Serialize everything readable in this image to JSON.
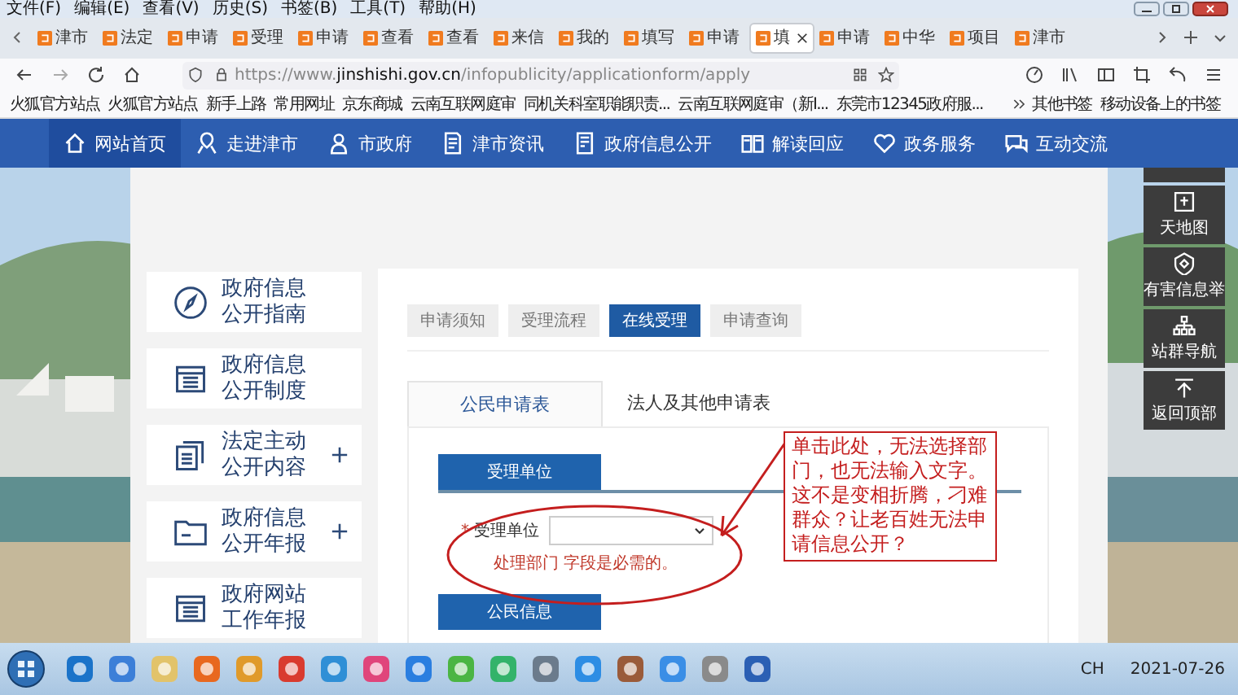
{
  "menu_bar": [
    "文件(F)",
    "编辑(E)",
    "查看(V)",
    "历史(S)",
    "书签(B)",
    "工具(T)",
    "帮助(H)"
  ],
  "browser_tabs": [
    {
      "label": "津市",
      "selected": false
    },
    {
      "label": "法定",
      "selected": false
    },
    {
      "label": "申请",
      "selected": false
    },
    {
      "label": "受理",
      "selected": false
    },
    {
      "label": "申请",
      "selected": false
    },
    {
      "label": "查看",
      "selected": false
    },
    {
      "label": "查看",
      "selected": false
    },
    {
      "label": "来信",
      "selected": false
    },
    {
      "label": "我的",
      "selected": false
    },
    {
      "label": "填写",
      "selected": false
    },
    {
      "label": "申请",
      "selected": false
    },
    {
      "label": "填",
      "selected": true
    },
    {
      "label": "申请",
      "selected": false
    },
    {
      "label": "中华",
      "selected": false
    },
    {
      "label": "项目",
      "selected": false
    },
    {
      "label": "津市",
      "selected": false
    }
  ],
  "address_bar": {
    "url_prefix": "https://www.",
    "url_domain": "jinshishi.gov.cn",
    "url_path": "/infopublicity/applicationform/apply"
  },
  "bookmarks": [
    "火狐官方站点",
    "火狐官方站点",
    "新手上路",
    "常用网址",
    "京东商城",
    "云南互联网庭审",
    "同机关科室职能职责...",
    "云南互联网庭审（新I...",
    "东莞市12345政府服..."
  ],
  "bookmarks_right": [
    "其他书签",
    "移动设备上的书签"
  ],
  "nav": [
    {
      "label": "网站首页",
      "selected": true
    },
    {
      "label": "走进津市",
      "selected": false
    },
    {
      "label": "市政府",
      "selected": false
    },
    {
      "label": "津市资讯",
      "selected": false
    },
    {
      "label": "政府信息公开",
      "selected": false
    },
    {
      "label": "解读回应",
      "selected": false
    },
    {
      "label": "政务服务",
      "selected": false
    },
    {
      "label": "互动交流",
      "selected": false
    }
  ],
  "side_menu": [
    {
      "lines": [
        "政府信息",
        "公开指南"
      ],
      "expandable": false
    },
    {
      "lines": [
        "政府信息",
        "公开制度"
      ],
      "expandable": false
    },
    {
      "lines": [
        "法定主动",
        "公开内容"
      ],
      "expandable": true
    },
    {
      "lines": [
        "政府信息",
        "公开年报"
      ],
      "expandable": true
    },
    {
      "lines": [
        "政府网站",
        "工作年报"
      ],
      "expandable": false
    }
  ],
  "sub_tabs": [
    {
      "label": "申请须知",
      "selected": false
    },
    {
      "label": "受理流程",
      "selected": false
    },
    {
      "label": "在线受理",
      "selected": true
    },
    {
      "label": "申请查询",
      "selected": false
    }
  ],
  "form_tabs": [
    {
      "label": "公民申请表",
      "selected": true
    },
    {
      "label": "法人及其他申请表",
      "selected": false
    }
  ],
  "sections": [
    "受理单位",
    "公民信息"
  ],
  "field": {
    "required_mark": "*",
    "label": "受理单位",
    "error": "处理部门 字段是必需的。"
  },
  "annotation": "单击此处，无法选择部门，也无法输入文字。这不是变相折腾，刁难群众？让老百姓无法申请信息公开？",
  "tools": [
    "天地图",
    "有害信息举",
    "站群导航",
    "返回顶部"
  ],
  "taskbar": {
    "tray": "CH",
    "date": "2021-07-26"
  }
}
